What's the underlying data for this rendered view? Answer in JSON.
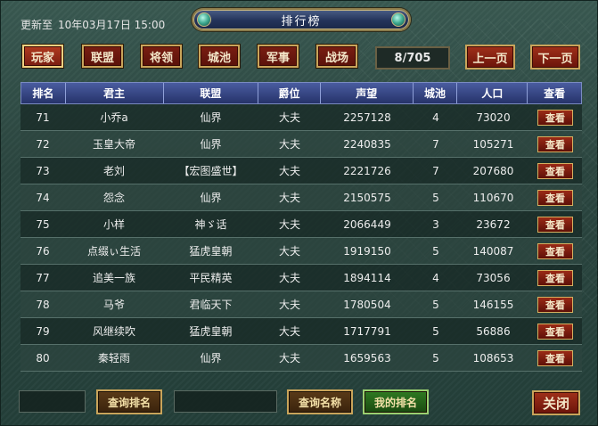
{
  "header": {
    "updated_prefix": "更新至",
    "updated_time": "10年03月17日 15:00",
    "title": "排行榜"
  },
  "tabs": [
    {
      "label": "玩家",
      "active": true
    },
    {
      "label": "联盟",
      "active": false
    },
    {
      "label": "将领",
      "active": false
    },
    {
      "label": "城池",
      "active": false
    },
    {
      "label": "军事",
      "active": false
    },
    {
      "label": "战场",
      "active": false
    }
  ],
  "pagination": {
    "indicator": "8/705",
    "prev_label": "上一页",
    "next_label": "下一页"
  },
  "table": {
    "columns": [
      "排名",
      "君主",
      "联盟",
      "爵位",
      "声望",
      "城池",
      "人口",
      "查看"
    ],
    "view_label": "查看",
    "rows": [
      {
        "rank": "71",
        "lord": "小乔a",
        "alliance": "仙界",
        "title": "大夫",
        "fame": "2257128",
        "cities": "4",
        "population": "73020"
      },
      {
        "rank": "72",
        "lord": "玉皇大帝",
        "alliance": "仙界",
        "title": "大夫",
        "fame": "2240835",
        "cities": "7",
        "population": "105271"
      },
      {
        "rank": "73",
        "lord": "老刘",
        "alliance": "【宏图盛世】",
        "title": "大夫",
        "fame": "2221726",
        "cities": "7",
        "population": "207680"
      },
      {
        "rank": "74",
        "lord": "怨念",
        "alliance": "仙界",
        "title": "大夫",
        "fame": "2150575",
        "cities": "5",
        "population": "110670"
      },
      {
        "rank": "75",
        "lord": "小样",
        "alliance": "神ゞ话",
        "title": "大夫",
        "fame": "2066449",
        "cities": "3",
        "population": "23672"
      },
      {
        "rank": "76",
        "lord": "点缀ぃ生活",
        "alliance": "猛虎皇朝",
        "title": "大夫",
        "fame": "1919150",
        "cities": "5",
        "population": "140087"
      },
      {
        "rank": "77",
        "lord": "追美一族",
        "alliance": "平民精英",
        "title": "大夫",
        "fame": "1894114",
        "cities": "4",
        "population": "73056"
      },
      {
        "rank": "78",
        "lord": "马爷",
        "alliance": "君临天下",
        "title": "大夫",
        "fame": "1780504",
        "cities": "5",
        "population": "146155"
      },
      {
        "rank": "79",
        "lord": "风继续吹",
        "alliance": "猛虎皇朝",
        "title": "大夫",
        "fame": "1717791",
        "cities": "5",
        "population": "56886"
      },
      {
        "rank": "80",
        "lord": "秦轻雨",
        "alliance": "仙界",
        "title": "大夫",
        "fame": "1659563",
        "cities": "5",
        "population": "108653"
      }
    ]
  },
  "bottom": {
    "rank_input_value": "",
    "query_rank_label": "查询排名",
    "name_input_value": "",
    "query_name_label": "查询名称",
    "my_rank_label": "我的排名",
    "close_label": "关闭"
  },
  "colors": {
    "accent_red": "#7a1e12",
    "gold_border": "#c9a45a",
    "header_blue": "#26336a",
    "green_button": "#2f7a22"
  }
}
